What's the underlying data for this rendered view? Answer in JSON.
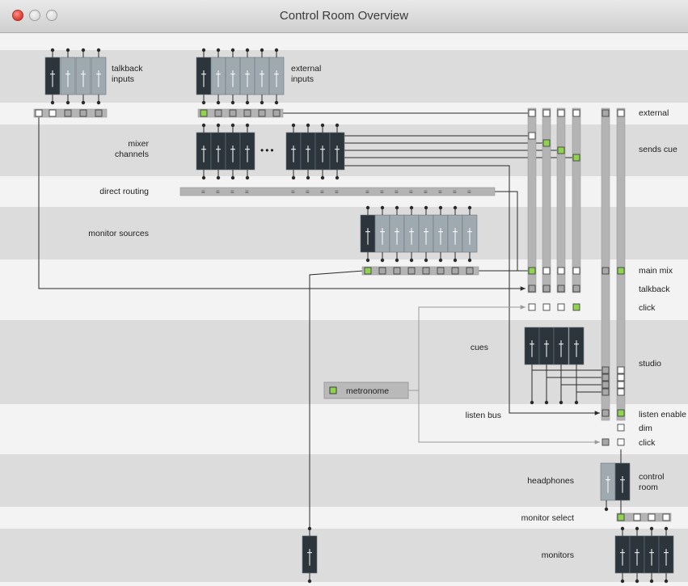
{
  "window": {
    "title": "Control Room Overview"
  },
  "labels": {
    "talkback_inputs_1": "talkback",
    "talkback_inputs_2": "inputs",
    "external_inputs_1": "external",
    "external_inputs_2": "inputs",
    "mixer_channels_1": "mixer",
    "mixer_channels_2": "channels",
    "ellipsis": "•••",
    "direct_routing": "direct routing",
    "monitor_sources": "monitor sources",
    "cues": "cues",
    "metronome": "metronome",
    "listen_bus": "listen bus",
    "headphones": "headphones",
    "monitor_select": "monitor select",
    "monitors": "monitors",
    "control_room_1": "control",
    "control_room_2": "room",
    "right_external": "external",
    "right_sends_cue": "sends cue",
    "right_main_mix": "main mix",
    "right_talkback": "talkback",
    "right_click": "click",
    "right_studio": "studio",
    "right_listen_enable": "listen enable",
    "right_dim": "dim",
    "right_click2": "click"
  },
  "colors": {
    "dark_fader": "#2c343c",
    "light_fader": "#9fa9b0",
    "node_on": "#8fd34f",
    "band_dark": "#dcdcdc",
    "band_light": "#f3f3f3",
    "line": "#2a2a2a",
    "grey_line": "#9a9a9a",
    "bus": "#b4b4b4"
  }
}
